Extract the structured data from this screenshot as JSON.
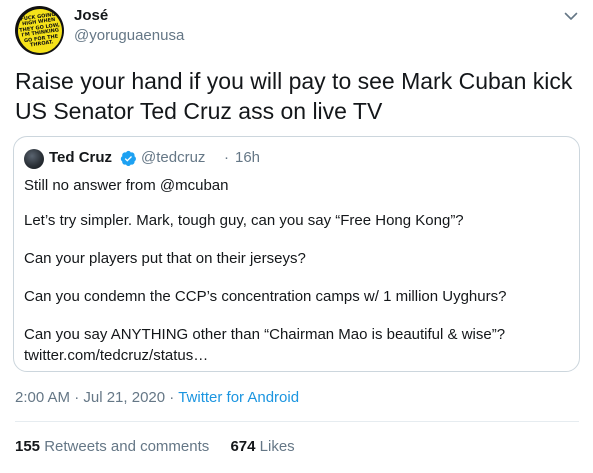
{
  "tweet": {
    "author": {
      "name": "José",
      "handle": "@yoruguaenusa"
    },
    "avatar_text": [
      "FUCK GOING",
      "HIGH WHEN",
      "THEY GO LOW,",
      "I'M THINKING",
      "GO FOR THE",
      "THROAT."
    ],
    "text": "Raise your hand if you will pay to see Mark Cuban kick US Senator Ted Cruz ass on live TV",
    "timestamp": "2:00 AM · Jul 21, 2020",
    "separator": "·",
    "source": "Twitter for Android",
    "stats": {
      "retweets_count": "155",
      "retweets_label": "Retweets and comments",
      "likes_count": "674",
      "likes_label": "Likes"
    }
  },
  "quoted_tweet": {
    "name": "Ted Cruz",
    "handle": "@tedcruz",
    "dot": "·",
    "time": "16h",
    "lines": [
      "Still no answer from @mcuban",
      "Let’s try simpler. Mark, tough guy, can you say “Free Hong Kong”?",
      "Can your players put that on their jerseys?",
      "Can you condemn the CCP’s concentration camps w/ 1 million Uyghurs?",
      "Can you say ANYTHING other than “Chairman Mao is beautiful & wise”?",
      "twitter.com/tedcruz/status…"
    ]
  },
  "colors": {
    "text": "#14171a",
    "secondary": "#657786",
    "link": "#1b95e0",
    "border": "#ccd6dd",
    "verified": "#1da1f2"
  },
  "icons": {
    "more": "chevron-down-icon",
    "verified": "verified-badge-icon"
  }
}
